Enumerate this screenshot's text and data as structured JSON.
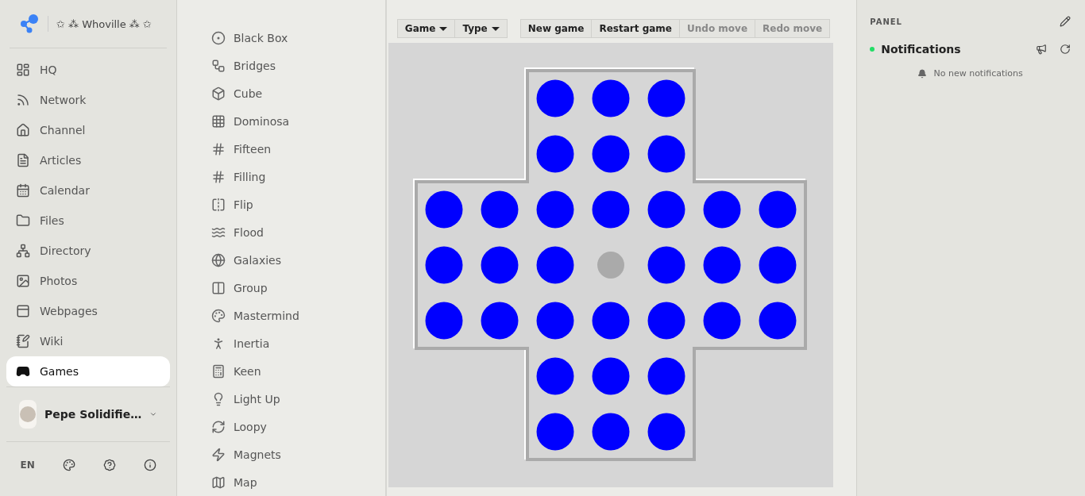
{
  "brand": {
    "title": "✩ ⁂ Whoville ⁂ ✩"
  },
  "nav": [
    {
      "label": "HQ",
      "selected": false
    },
    {
      "label": "Network",
      "selected": false
    },
    {
      "label": "Channel",
      "selected": false
    },
    {
      "label": "Articles",
      "selected": false
    },
    {
      "label": "Calendar",
      "selected": false
    },
    {
      "label": "Files",
      "selected": false
    },
    {
      "label": "Directory",
      "selected": false
    },
    {
      "label": "Photos",
      "selected": false
    },
    {
      "label": "Webpages",
      "selected": false
    },
    {
      "label": "Wiki",
      "selected": false
    },
    {
      "label": "Games",
      "selected": true
    }
  ],
  "user": {
    "name": "Pepe Solidifie…"
  },
  "footer": {
    "language": "EN"
  },
  "games": [
    {
      "label": "Black Box"
    },
    {
      "label": "Bridges"
    },
    {
      "label": "Cube"
    },
    {
      "label": "Dominosa"
    },
    {
      "label": "Fifteen"
    },
    {
      "label": "Filling"
    },
    {
      "label": "Flip"
    },
    {
      "label": "Flood"
    },
    {
      "label": "Galaxies"
    },
    {
      "label": "Group"
    },
    {
      "label": "Mastermind"
    },
    {
      "label": "Inertia"
    },
    {
      "label": "Keen"
    },
    {
      "label": "Light Up"
    },
    {
      "label": "Loopy"
    },
    {
      "label": "Magnets"
    },
    {
      "label": "Map"
    }
  ],
  "toolbar": {
    "menus": [
      {
        "label": "Game"
      },
      {
        "label": "Type"
      }
    ],
    "actions": [
      {
        "label": "New game",
        "disabled": false
      },
      {
        "label": "Restart game",
        "disabled": false
      },
      {
        "label": "Undo move",
        "disabled": true
      },
      {
        "label": "Redo move",
        "disabled": true
      }
    ]
  },
  "board": {
    "rows": [
      [
        {
          "peg": true
        },
        {
          "peg": true
        },
        {
          "peg": true
        }
      ],
      [
        {
          "peg": true
        },
        {
          "peg": true
        },
        {
          "peg": true
        }
      ],
      [
        {
          "peg": true
        },
        {
          "peg": true
        },
        {
          "peg": true
        },
        {
          "peg": true
        },
        {
          "peg": true
        },
        {
          "peg": true
        },
        {
          "peg": true
        }
      ],
      [
        {
          "peg": true
        },
        {
          "peg": true
        },
        {
          "peg": true
        },
        {
          "peg": false
        },
        {
          "peg": true
        },
        {
          "peg": true
        },
        {
          "peg": true
        }
      ],
      [
        {
          "peg": true
        },
        {
          "peg": true
        },
        {
          "peg": true
        },
        {
          "peg": true
        },
        {
          "peg": true
        },
        {
          "peg": true
        },
        {
          "peg": true
        }
      ],
      [
        {
          "peg": true
        },
        {
          "peg": true
        },
        {
          "peg": true
        }
      ],
      [
        {
          "peg": true
        },
        {
          "peg": true
        },
        {
          "peg": true
        }
      ]
    ]
  },
  "panel": {
    "title": "PANEL",
    "section": "Notifications",
    "online": true,
    "empty": "No new notifications"
  }
}
